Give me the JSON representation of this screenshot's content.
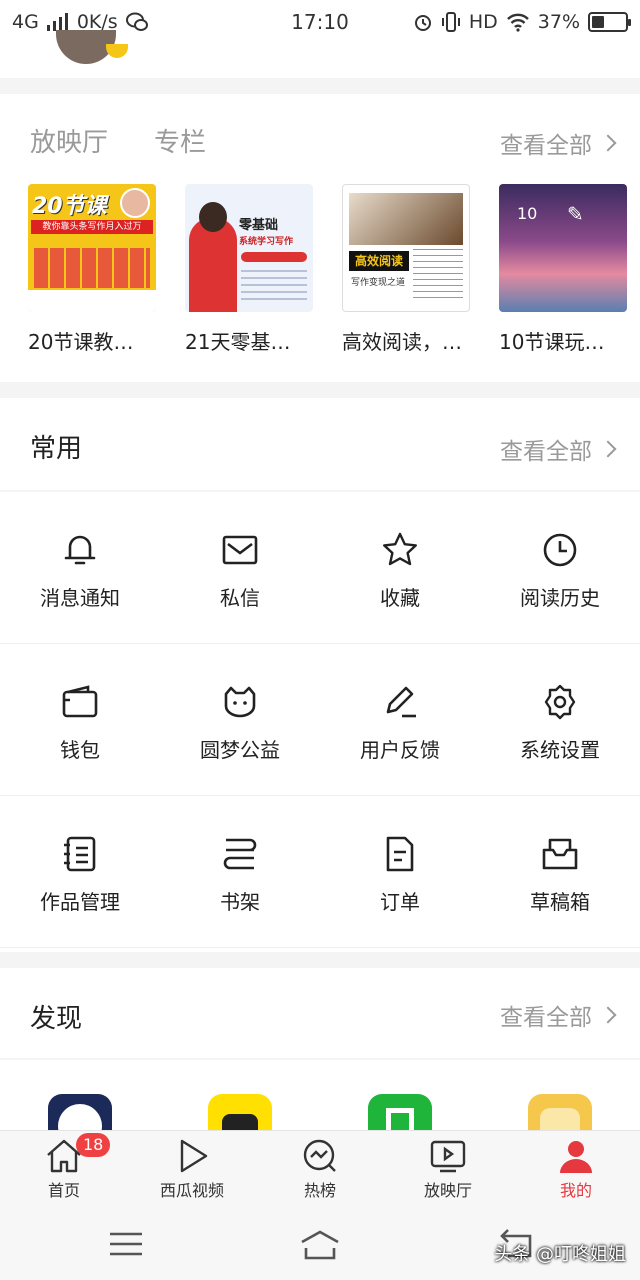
{
  "status_bar": {
    "network": "4G",
    "speed": "0K/s",
    "time": "17:10",
    "hd": "HD",
    "battery": "37%",
    "battery_level": 0.37
  },
  "showroom": {
    "tabs": [
      "放映厅",
      "专栏"
    ],
    "view_all": "查看全部",
    "courses": [
      {
        "title": "20节课教…",
        "thumb_text": "20节课",
        "thumb_sub": "教你靠头条写作月入过万"
      },
      {
        "title": "21天零基…",
        "thumb_text": "零基础",
        "thumb_sub": "系统学习写作"
      },
      {
        "title": "高效阅读，…",
        "thumb_text": "高效阅读",
        "thumb_sub": "写作变现之道"
      },
      {
        "title": "10节课玩…",
        "thumb_text": "10",
        "thumb_sub": ""
      }
    ]
  },
  "common": {
    "title": "常用",
    "view_all": "查看全部",
    "items": [
      {
        "label": "消息通知",
        "icon": "bell-icon"
      },
      {
        "label": "私信",
        "icon": "mail-icon"
      },
      {
        "label": "收藏",
        "icon": "star-icon"
      },
      {
        "label": "阅读历史",
        "icon": "clock-icon"
      },
      {
        "label": "钱包",
        "icon": "wallet-icon"
      },
      {
        "label": "圆梦公益",
        "icon": "cat-face-icon"
      },
      {
        "label": "用户反馈",
        "icon": "pencil-icon"
      },
      {
        "label": "系统设置",
        "icon": "gear-icon"
      },
      {
        "label": "作品管理",
        "icon": "notebook-icon"
      },
      {
        "label": "书架",
        "icon": "bookshelf-icon"
      },
      {
        "label": "订单",
        "icon": "document-icon"
      },
      {
        "label": "草稿箱",
        "icon": "drafts-box-icon"
      }
    ]
  },
  "discover": {
    "title": "发现",
    "view_all": "查看全部"
  },
  "bottom_nav": {
    "items": [
      {
        "label": "首页",
        "icon": "home-icon",
        "badge": "18"
      },
      {
        "label": "西瓜视频",
        "icon": "play-icon"
      },
      {
        "label": "热榜",
        "icon": "trending-icon"
      },
      {
        "label": "放映厅",
        "icon": "tv-icon"
      },
      {
        "label": "我的",
        "icon": "user-icon",
        "active": true
      }
    ],
    "active_color": "#e5393f"
  },
  "watermark": "头条 @叮咚姐姐"
}
